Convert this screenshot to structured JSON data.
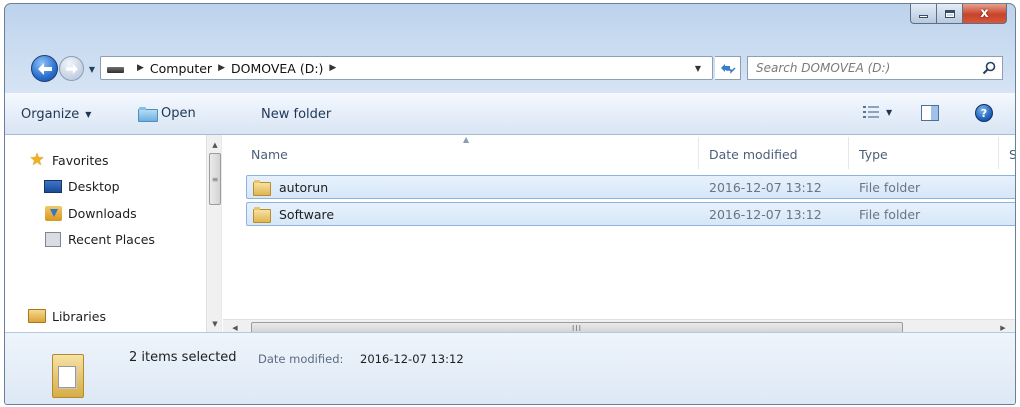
{
  "window": {
    "controls": {
      "close_glyph": "x"
    }
  },
  "navigation": {
    "breadcrumbs": [
      "Computer",
      "DOMOVEA (D:)"
    ],
    "search_placeholder": "Search DOMOVEA (D:)"
  },
  "toolbar": {
    "organize_label": "Organize",
    "open_label": "Open",
    "new_folder_label": "New folder",
    "help_label": "?"
  },
  "sidebar": {
    "favorites_label": "Favorites",
    "items": [
      {
        "label": "Desktop",
        "icon": "desktop-icon"
      },
      {
        "label": "Downloads",
        "icon": "downloads-icon"
      },
      {
        "label": "Recent Places",
        "icon": "recent-places-icon"
      }
    ],
    "libraries_label": "Libraries"
  },
  "file_list": {
    "columns": [
      "Name",
      "Date modified",
      "Type",
      "S"
    ],
    "rows": [
      {
        "name": "autorun",
        "date_modified": "2016-12-07 13:12",
        "type": "File folder",
        "selected": true
      },
      {
        "name": "Software",
        "date_modified": "2016-12-07 13:12",
        "type": "File folder",
        "selected": true
      }
    ],
    "h_scroll_grip": "III"
  },
  "details": {
    "selection_text": "2 items selected",
    "date_label": "Date modified:",
    "date_value": "2016-12-07 13:12"
  },
  "colors": {
    "selection_border": "#8fb3e0",
    "selection_fill": "#d6e7f9",
    "close_button": "#c7442b",
    "back_button": "#2a6fcf"
  }
}
